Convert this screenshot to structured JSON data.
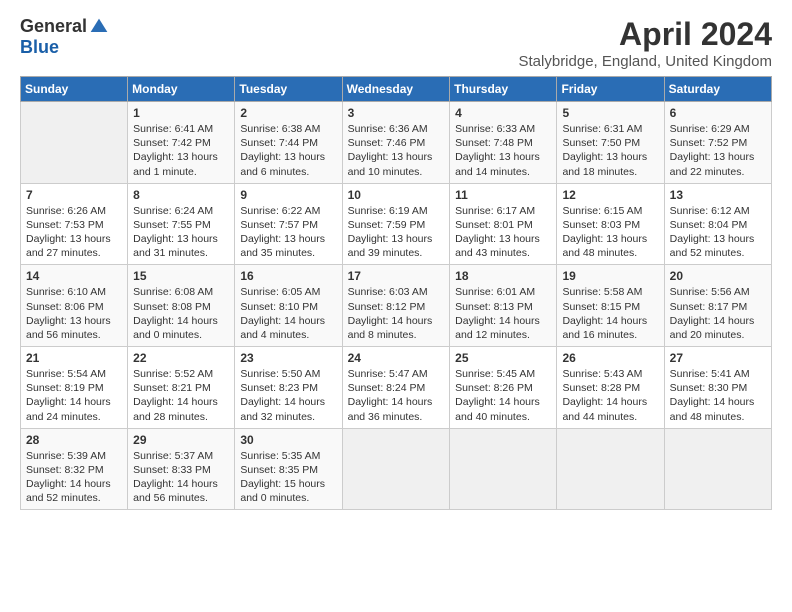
{
  "logo": {
    "general": "General",
    "blue": "Blue"
  },
  "title": {
    "month_year": "April 2024",
    "location": "Stalybridge, England, United Kingdom"
  },
  "header_days": [
    "Sunday",
    "Monday",
    "Tuesday",
    "Wednesday",
    "Thursday",
    "Friday",
    "Saturday"
  ],
  "weeks": [
    [
      {
        "day": "",
        "content": ""
      },
      {
        "day": "1",
        "content": "Sunrise: 6:41 AM\nSunset: 7:42 PM\nDaylight: 13 hours\nand 1 minute."
      },
      {
        "day": "2",
        "content": "Sunrise: 6:38 AM\nSunset: 7:44 PM\nDaylight: 13 hours\nand 6 minutes."
      },
      {
        "day": "3",
        "content": "Sunrise: 6:36 AM\nSunset: 7:46 PM\nDaylight: 13 hours\nand 10 minutes."
      },
      {
        "day": "4",
        "content": "Sunrise: 6:33 AM\nSunset: 7:48 PM\nDaylight: 13 hours\nand 14 minutes."
      },
      {
        "day": "5",
        "content": "Sunrise: 6:31 AM\nSunset: 7:50 PM\nDaylight: 13 hours\nand 18 minutes."
      },
      {
        "day": "6",
        "content": "Sunrise: 6:29 AM\nSunset: 7:52 PM\nDaylight: 13 hours\nand 22 minutes."
      }
    ],
    [
      {
        "day": "7",
        "content": "Sunrise: 6:26 AM\nSunset: 7:53 PM\nDaylight: 13 hours\nand 27 minutes."
      },
      {
        "day": "8",
        "content": "Sunrise: 6:24 AM\nSunset: 7:55 PM\nDaylight: 13 hours\nand 31 minutes."
      },
      {
        "day": "9",
        "content": "Sunrise: 6:22 AM\nSunset: 7:57 PM\nDaylight: 13 hours\nand 35 minutes."
      },
      {
        "day": "10",
        "content": "Sunrise: 6:19 AM\nSunset: 7:59 PM\nDaylight: 13 hours\nand 39 minutes."
      },
      {
        "day": "11",
        "content": "Sunrise: 6:17 AM\nSunset: 8:01 PM\nDaylight: 13 hours\nand 43 minutes."
      },
      {
        "day": "12",
        "content": "Sunrise: 6:15 AM\nSunset: 8:03 PM\nDaylight: 13 hours\nand 48 minutes."
      },
      {
        "day": "13",
        "content": "Sunrise: 6:12 AM\nSunset: 8:04 PM\nDaylight: 13 hours\nand 52 minutes."
      }
    ],
    [
      {
        "day": "14",
        "content": "Sunrise: 6:10 AM\nSunset: 8:06 PM\nDaylight: 13 hours\nand 56 minutes."
      },
      {
        "day": "15",
        "content": "Sunrise: 6:08 AM\nSunset: 8:08 PM\nDaylight: 14 hours\nand 0 minutes."
      },
      {
        "day": "16",
        "content": "Sunrise: 6:05 AM\nSunset: 8:10 PM\nDaylight: 14 hours\nand 4 minutes."
      },
      {
        "day": "17",
        "content": "Sunrise: 6:03 AM\nSunset: 8:12 PM\nDaylight: 14 hours\nand 8 minutes."
      },
      {
        "day": "18",
        "content": "Sunrise: 6:01 AM\nSunset: 8:13 PM\nDaylight: 14 hours\nand 12 minutes."
      },
      {
        "day": "19",
        "content": "Sunrise: 5:58 AM\nSunset: 8:15 PM\nDaylight: 14 hours\nand 16 minutes."
      },
      {
        "day": "20",
        "content": "Sunrise: 5:56 AM\nSunset: 8:17 PM\nDaylight: 14 hours\nand 20 minutes."
      }
    ],
    [
      {
        "day": "21",
        "content": "Sunrise: 5:54 AM\nSunset: 8:19 PM\nDaylight: 14 hours\nand 24 minutes."
      },
      {
        "day": "22",
        "content": "Sunrise: 5:52 AM\nSunset: 8:21 PM\nDaylight: 14 hours\nand 28 minutes."
      },
      {
        "day": "23",
        "content": "Sunrise: 5:50 AM\nSunset: 8:23 PM\nDaylight: 14 hours\nand 32 minutes."
      },
      {
        "day": "24",
        "content": "Sunrise: 5:47 AM\nSunset: 8:24 PM\nDaylight: 14 hours\nand 36 minutes."
      },
      {
        "day": "25",
        "content": "Sunrise: 5:45 AM\nSunset: 8:26 PM\nDaylight: 14 hours\nand 40 minutes."
      },
      {
        "day": "26",
        "content": "Sunrise: 5:43 AM\nSunset: 8:28 PM\nDaylight: 14 hours\nand 44 minutes."
      },
      {
        "day": "27",
        "content": "Sunrise: 5:41 AM\nSunset: 8:30 PM\nDaylight: 14 hours\nand 48 minutes."
      }
    ],
    [
      {
        "day": "28",
        "content": "Sunrise: 5:39 AM\nSunset: 8:32 PM\nDaylight: 14 hours\nand 52 minutes."
      },
      {
        "day": "29",
        "content": "Sunrise: 5:37 AM\nSunset: 8:33 PM\nDaylight: 14 hours\nand 56 minutes."
      },
      {
        "day": "30",
        "content": "Sunrise: 5:35 AM\nSunset: 8:35 PM\nDaylight: 15 hours\nand 0 minutes."
      },
      {
        "day": "",
        "content": ""
      },
      {
        "day": "",
        "content": ""
      },
      {
        "day": "",
        "content": ""
      },
      {
        "day": "",
        "content": ""
      }
    ]
  ]
}
